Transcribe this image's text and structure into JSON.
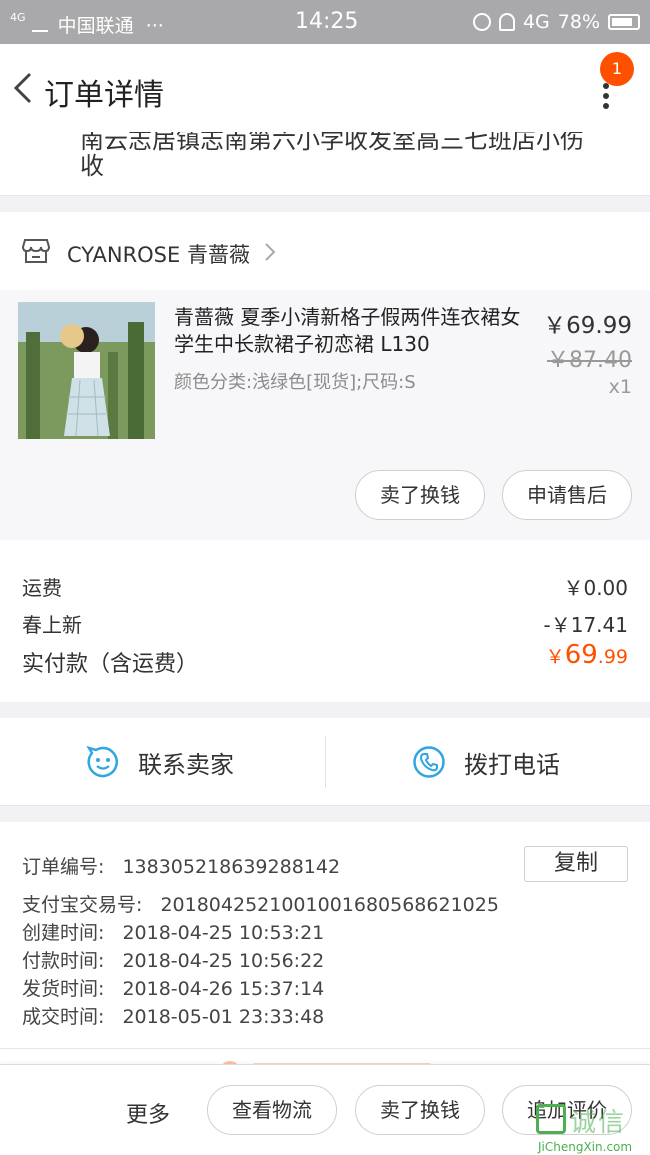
{
  "status_bar": {
    "network_tag": "4G",
    "carrier": "中国联通",
    "ellipsis": "···",
    "time": "14:25",
    "network": "4G",
    "battery": "78%"
  },
  "nav": {
    "title": "订单详情",
    "badge_count": "1"
  },
  "address": {
    "line1": "南云志居镇志南第六小学收发室高三七班店小伤",
    "line2": "收"
  },
  "shop": {
    "name": "CYANROSE 青蔷薇"
  },
  "item": {
    "title": "青蔷薇 夏季小清新格子假两件连衣裙女学生中长款裙子初恋裙 L130",
    "sku": "颜色分类:浅绿色[现货];尺码:S",
    "price": "￥69.99",
    "original_price": "￥87.40",
    "quantity": "x1",
    "actions": [
      "卖了换钱",
      "申请售后"
    ]
  },
  "summary": {
    "shipping_label": "运费",
    "shipping_value": "￥0.00",
    "discount_label": "春上新",
    "discount_value": "-￥17.41",
    "paid_label": "实付款（含运费）",
    "paid_currency": "￥",
    "paid_int": "69",
    "paid_dec": ".99"
  },
  "contact": {
    "seller": "联系卖家",
    "call": "拨打电话"
  },
  "order_info": {
    "order_no_label": "订单编号:",
    "order_no": "138305218639288142",
    "copy": "复制",
    "alipay_label": "支付宝交易号:",
    "alipay_no": "2018042521001001680568621025",
    "created_label": "创建时间:",
    "created": "2018-04-25 10:53:21",
    "paid_time_label": "付款时间:",
    "paid_time": "2018-04-25 10:56:22",
    "shipped_label": "发货时间:",
    "shipped": "2018-04-26 15:37:14",
    "completed_label": "成交时间:",
    "completed": "2018-05-01 23:33:48"
  },
  "bottom_bar": {
    "more": "更多",
    "buttons": [
      "查看物流",
      "卖了换钱",
      "追加评价"
    ]
  },
  "watermark": {
    "text": "诚信",
    "sub": "JiChengXin.com"
  },
  "colors": {
    "accent": "#ff5000",
    "contact_icon": "#2ea7e0"
  }
}
